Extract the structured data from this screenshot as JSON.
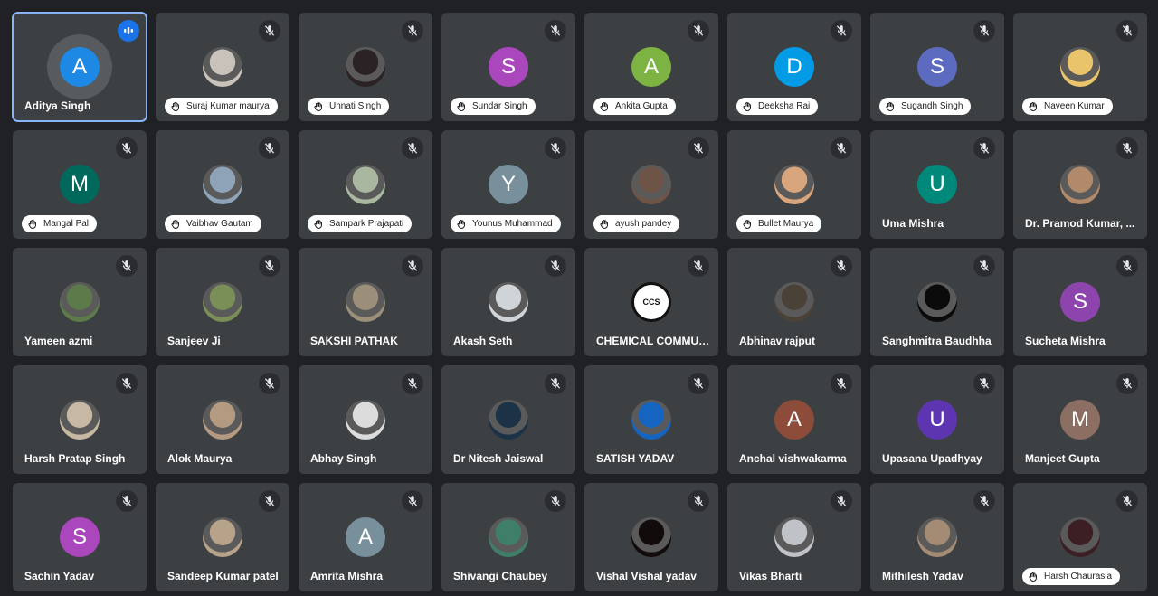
{
  "colors": {
    "background": "#202124",
    "tile": "#3c4043",
    "active_speaker_border": "#8ab4f8",
    "speaking_indicator": "#1a73e8"
  },
  "participants": [
    {
      "name": "Aditya Singh",
      "initial": "A",
      "avatar_color": "#1e88e5",
      "hand_raised": false,
      "muted": false,
      "speaking": true
    },
    {
      "name": "Suraj Kumar maurya",
      "initial": "",
      "avatar_color": "#c9c2bb",
      "hand_raised": true,
      "muted": true,
      "speaking": false,
      "photo": true
    },
    {
      "name": "Unnati Singh",
      "initial": "",
      "avatar_color": "#2a2224",
      "hand_raised": true,
      "muted": true,
      "speaking": false,
      "photo": true
    },
    {
      "name": "Sundar Singh",
      "initial": "S",
      "avatar_color": "#ab47bc",
      "hand_raised": true,
      "muted": true,
      "speaking": false
    },
    {
      "name": "Ankita Gupta",
      "initial": "A",
      "avatar_color": "#7cb342",
      "hand_raised": true,
      "muted": true,
      "speaking": false
    },
    {
      "name": "Deeksha Rai",
      "initial": "D",
      "avatar_color": "#039be5",
      "hand_raised": true,
      "muted": true,
      "speaking": false
    },
    {
      "name": "Sugandh Singh",
      "initial": "S",
      "avatar_color": "#5c6bc0",
      "hand_raised": true,
      "muted": true,
      "speaking": false
    },
    {
      "name": "Naveen Kumar",
      "initial": "",
      "avatar_color": "#e9c46a",
      "hand_raised": true,
      "muted": true,
      "speaking": false,
      "photo": true
    },
    {
      "name": "Mangal Pal",
      "initial": "M",
      "avatar_color": "#00695c",
      "hand_raised": true,
      "muted": true,
      "speaking": false
    },
    {
      "name": "Vaibhav Gautam",
      "initial": "",
      "avatar_color": "#8fa3b8",
      "hand_raised": true,
      "muted": true,
      "speaking": false,
      "photo": true
    },
    {
      "name": "Sampark Prajapati",
      "initial": "",
      "avatar_color": "#a9b7a0",
      "hand_raised": true,
      "muted": true,
      "speaking": false,
      "photo": true
    },
    {
      "name": "Younus Muhammad",
      "initial": "Y",
      "avatar_color": "#78909c",
      "hand_raised": true,
      "muted": true,
      "speaking": false
    },
    {
      "name": "ayush pandey",
      "initial": "",
      "avatar_color": "#6d5447",
      "hand_raised": true,
      "muted": true,
      "speaking": false,
      "photo": true
    },
    {
      "name": "Bullet Maurya",
      "initial": "",
      "avatar_color": "#d9a57c",
      "hand_raised": true,
      "muted": true,
      "speaking": false,
      "photo": true
    },
    {
      "name": "Uma Mishra",
      "initial": "U",
      "avatar_color": "#00897b",
      "hand_raised": false,
      "muted": true,
      "speaking": false
    },
    {
      "name": "Dr. Pramod Kumar, ...",
      "initial": "",
      "avatar_color": "#b08a6a",
      "hand_raised": false,
      "muted": true,
      "speaking": false,
      "photo": true
    },
    {
      "name": "Yameen azmi",
      "initial": "",
      "avatar_color": "#5d7a4a",
      "hand_raised": false,
      "muted": true,
      "speaking": false,
      "photo": true
    },
    {
      "name": "Sanjeev Ji",
      "initial": "",
      "avatar_color": "#7a8f58",
      "hand_raised": false,
      "muted": true,
      "speaking": false,
      "photo": true
    },
    {
      "name": "SAKSHI PATHAK",
      "initial": "",
      "avatar_color": "#9c8f7a",
      "hand_raised": false,
      "muted": true,
      "speaking": false,
      "photo": true
    },
    {
      "name": "Akash Seth",
      "initial": "",
      "avatar_color": "#cfd4d8",
      "hand_raised": false,
      "muted": true,
      "speaking": false,
      "photo": true
    },
    {
      "name": "CHEMICAL COMMUNITY",
      "initial": "CCS",
      "avatar_color": "#111111",
      "hand_raised": false,
      "muted": true,
      "speaking": false,
      "logo": true
    },
    {
      "name": "Abhinav rajput",
      "initial": "",
      "avatar_color": "#4a4236",
      "hand_raised": false,
      "muted": true,
      "speaking": false,
      "photo": true
    },
    {
      "name": "Sanghmitra Baudhha",
      "initial": "",
      "avatar_color": "#0b0b0b",
      "hand_raised": false,
      "muted": true,
      "speaking": false,
      "photo": true
    },
    {
      "name": "Sucheta Mishra",
      "initial": "S",
      "avatar_color": "#8e44ad",
      "hand_raised": false,
      "muted": true,
      "speaking": false
    },
    {
      "name": "Harsh Pratap Singh",
      "initial": "",
      "avatar_color": "#c7b8a3",
      "hand_raised": false,
      "muted": true,
      "speaking": false,
      "photo": true
    },
    {
      "name": "Alok Maurya",
      "initial": "",
      "avatar_color": "#b39a80",
      "hand_raised": false,
      "muted": true,
      "speaking": false,
      "photo": true
    },
    {
      "name": "Abhay Singh",
      "initial": "",
      "avatar_color": "#dcdcdc",
      "hand_raised": false,
      "muted": true,
      "speaking": false,
      "photo": true
    },
    {
      "name": "Dr Nitesh Jaiswal",
      "initial": "",
      "avatar_color": "#1c3347",
      "hand_raised": false,
      "muted": true,
      "speaking": false,
      "photo": true
    },
    {
      "name": "SATISH YADAV",
      "initial": "",
      "avatar_color": "#1565c0",
      "hand_raised": false,
      "muted": true,
      "speaking": false,
      "photo": true
    },
    {
      "name": "Anchal vishwakarma",
      "initial": "A",
      "avatar_color": "#8d4b3a",
      "hand_raised": false,
      "muted": true,
      "speaking": false
    },
    {
      "name": "Upasana Upadhyay",
      "initial": "U",
      "avatar_color": "#5e35b1",
      "hand_raised": false,
      "muted": true,
      "speaking": false
    },
    {
      "name": "Manjeet Gupta",
      "initial": "M",
      "avatar_color": "#8d6e63",
      "hand_raised": false,
      "muted": true,
      "speaking": false
    },
    {
      "name": "Sachin Yadav",
      "initial": "S",
      "avatar_color": "#ab47bc",
      "hand_raised": false,
      "muted": true,
      "speaking": false
    },
    {
      "name": "Sandeep Kumar patel",
      "initial": "",
      "avatar_color": "#b7a38a",
      "hand_raised": false,
      "muted": true,
      "speaking": false,
      "photo": true
    },
    {
      "name": "Amrita Mishra",
      "initial": "A",
      "avatar_color": "#78909c",
      "hand_raised": false,
      "muted": true,
      "speaking": false
    },
    {
      "name": "Shivangi Chaubey",
      "initial": "",
      "avatar_color": "#3f7f6a",
      "hand_raised": false,
      "muted": true,
      "speaking": false,
      "photo": true
    },
    {
      "name": "Vishal Vishal yadav",
      "initial": "",
      "avatar_color": "#120b0b",
      "hand_raised": false,
      "muted": true,
      "speaking": false,
      "photo": true
    },
    {
      "name": "Vikas Bharti",
      "initial": "",
      "avatar_color": "#bfc3c7",
      "hand_raised": false,
      "muted": true,
      "speaking": false,
      "photo": true
    },
    {
      "name": "Mithilesh Yadav",
      "initial": "",
      "avatar_color": "#a38b74",
      "hand_raised": false,
      "muted": true,
      "speaking": false,
      "photo": true
    },
    {
      "name": "Harsh Chaurasia",
      "initial": "",
      "avatar_color": "#3b1f24",
      "hand_raised": true,
      "muted": true,
      "speaking": false,
      "photo": true
    }
  ]
}
